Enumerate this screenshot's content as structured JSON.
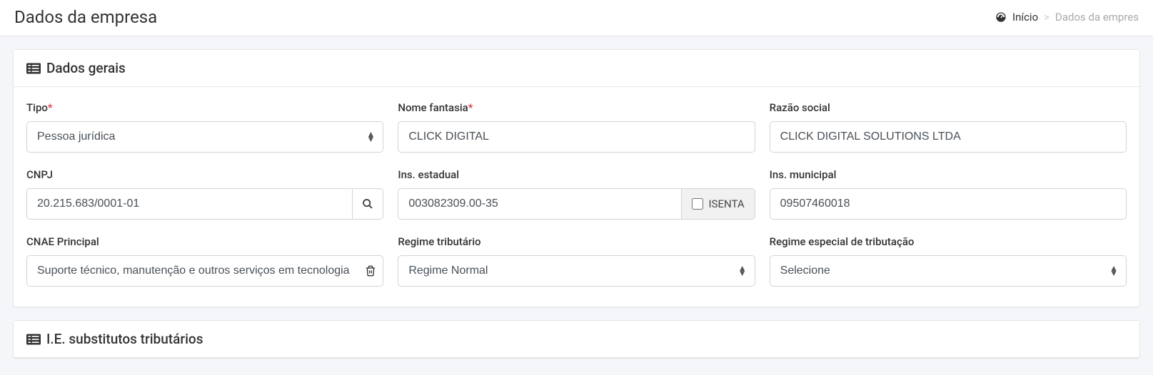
{
  "header": {
    "title": "Dados da empresa",
    "breadcrumb": {
      "home": "Início",
      "current": "Dados da empres"
    }
  },
  "panel1": {
    "title": "Dados gerais",
    "fields": {
      "tipo": {
        "label": "Tipo",
        "value": "Pessoa jurídica"
      },
      "nome_fantasia": {
        "label": "Nome fantasia",
        "value": "CLICK DIGITAL"
      },
      "razao_social": {
        "label": "Razão social",
        "value": "CLICK DIGITAL SOLUTIONS LTDA"
      },
      "cnpj": {
        "label": "CNPJ",
        "value": "20.215.683/0001-01"
      },
      "ins_estadual": {
        "label": "Ins. estadual",
        "value": "003082309.00-35",
        "isenta_label": "ISENTA"
      },
      "ins_municipal": {
        "label": "Ins. municipal",
        "value": "09507460018"
      },
      "cnae": {
        "label": "CNAE Principal",
        "value": "Suporte técnico, manutenção e outros serviços em tecnologia"
      },
      "regime_tributario": {
        "label": "Regime tributário",
        "value": "Regime Normal"
      },
      "regime_especial": {
        "label": "Regime especial de tributação",
        "value": "Selecione"
      }
    }
  },
  "panel2": {
    "title": "I.E. substitutos tributários"
  }
}
